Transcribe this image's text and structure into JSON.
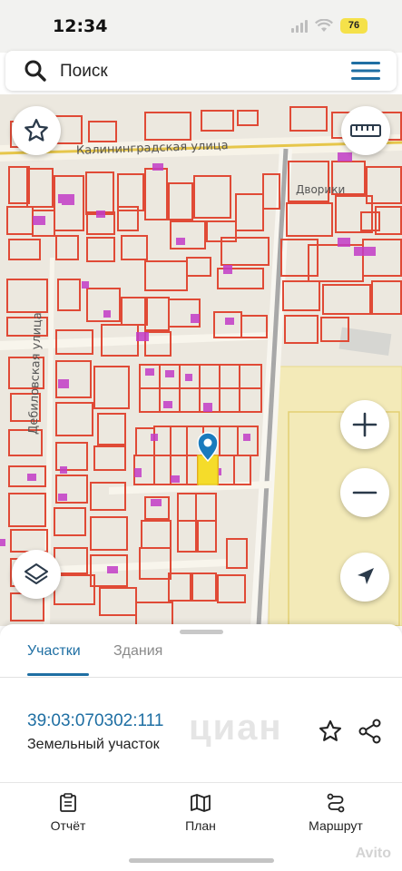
{
  "status_bar": {
    "time": "12:34",
    "battery": "76"
  },
  "search": {
    "placeholder": "Поиск"
  },
  "map": {
    "street_1": "Калининградская улица",
    "street_2": "Дебиловская улица",
    "poi": "Дворики"
  },
  "sheet": {
    "tabs": [
      "Участки",
      "Здания"
    ],
    "parcel": {
      "number": "39:03:070302:111",
      "type": "Земельный участок"
    },
    "watermark": "циан"
  },
  "bottom_nav": {
    "items": [
      {
        "label": "Отчёт",
        "icon": "report-icon"
      },
      {
        "label": "План",
        "icon": "map-plan-icon"
      },
      {
        "label": "Маршрут",
        "icon": "route-icon"
      }
    ]
  },
  "branding": {
    "avito": "Avito"
  },
  "colors": {
    "accent": "#1f6fa3",
    "parcel_border": "#e04a36",
    "building": "#c23cc7",
    "selected_parcel": "#f5dc2a"
  }
}
